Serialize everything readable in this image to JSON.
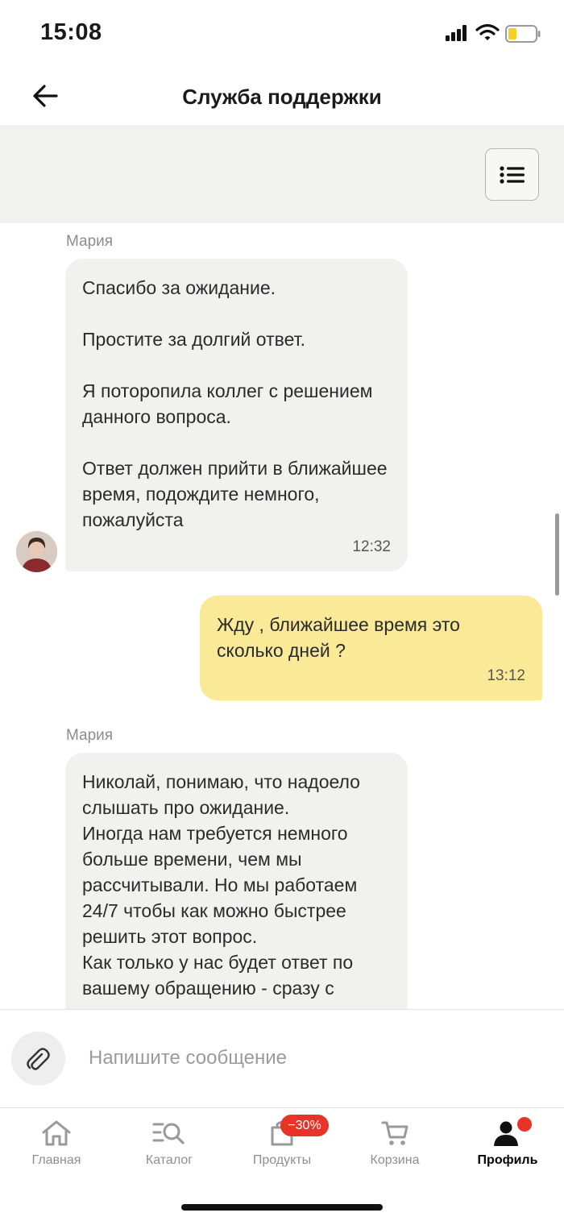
{
  "status_bar": {
    "time": "15:08"
  },
  "header": {
    "title": "Служба поддержки"
  },
  "chat": {
    "messages": [
      {
        "sender": "Мария",
        "direction": "incoming",
        "text": "Спасибо за ожидание.\n\nПростите за долгий ответ.\n\nЯ потoропила коллег с решением данного вопроса.\n\nОтвет должен прийти в ближайшее время, подождите немного, пожалуйста",
        "time": "12:32"
      },
      {
        "direction": "outgoing",
        "text": "Жду , ближайшее время это сколько дней ?",
        "time": "13:12"
      },
      {
        "sender": "Мария",
        "direction": "incoming",
        "text": "Николай, понимаю, что надоело слышать про ожидание.\nИногда нам требуется немного больше времени, чем мы рассчитывали. Но мы работаем 24/7 чтобы как можно быстрее решить этот вопрос.\nКак только у нас будет ответ по вашему обращению - сразу с"
      }
    ]
  },
  "composer": {
    "placeholder": "Напишите сообщение"
  },
  "tabbar": {
    "items": [
      {
        "label": "Главная",
        "icon": "home-icon"
      },
      {
        "label": "Каталог",
        "icon": "catalog-search-icon"
      },
      {
        "label": "Продукты",
        "icon": "grocery-bag-icon",
        "badge": "−30%"
      },
      {
        "label": "Корзина",
        "icon": "cart-icon"
      },
      {
        "label": "Профиль",
        "icon": "profile-icon",
        "active": true
      }
    ]
  },
  "colors": {
    "outgoing_bubble": "#faea98",
    "incoming_bubble": "#f1f1f0",
    "badge_red": "#e8332a"
  }
}
